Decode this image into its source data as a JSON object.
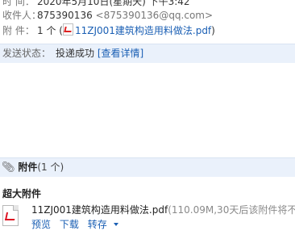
{
  "header": {
    "time_label": "时 间：",
    "time_value": "2020年5月10日(星期天) 下午3:42",
    "to_label": "收件人：",
    "to_name": "875390136",
    "to_email": "<875390136@qq.com>",
    "attach_label": "附 件：",
    "attach_count": "1 个 (",
    "attach_file": "11ZJ001建筑构造用料做法.pdf",
    "attach_close": ")"
  },
  "status": {
    "label": "发送状态：",
    "value": "投递成功",
    "details_link": "[查看详情]"
  },
  "attachments": {
    "title": "附件",
    "count": "(1 个)",
    "big_title": "超大附件",
    "file": {
      "name": "11ZJ001建筑构造用料做法.pdf",
      "meta": "(110.09M,30天后该附件将不",
      "icon": "pdf-icon",
      "actions": {
        "preview": "预览",
        "download": "下载",
        "forward": "转存"
      }
    }
  }
}
